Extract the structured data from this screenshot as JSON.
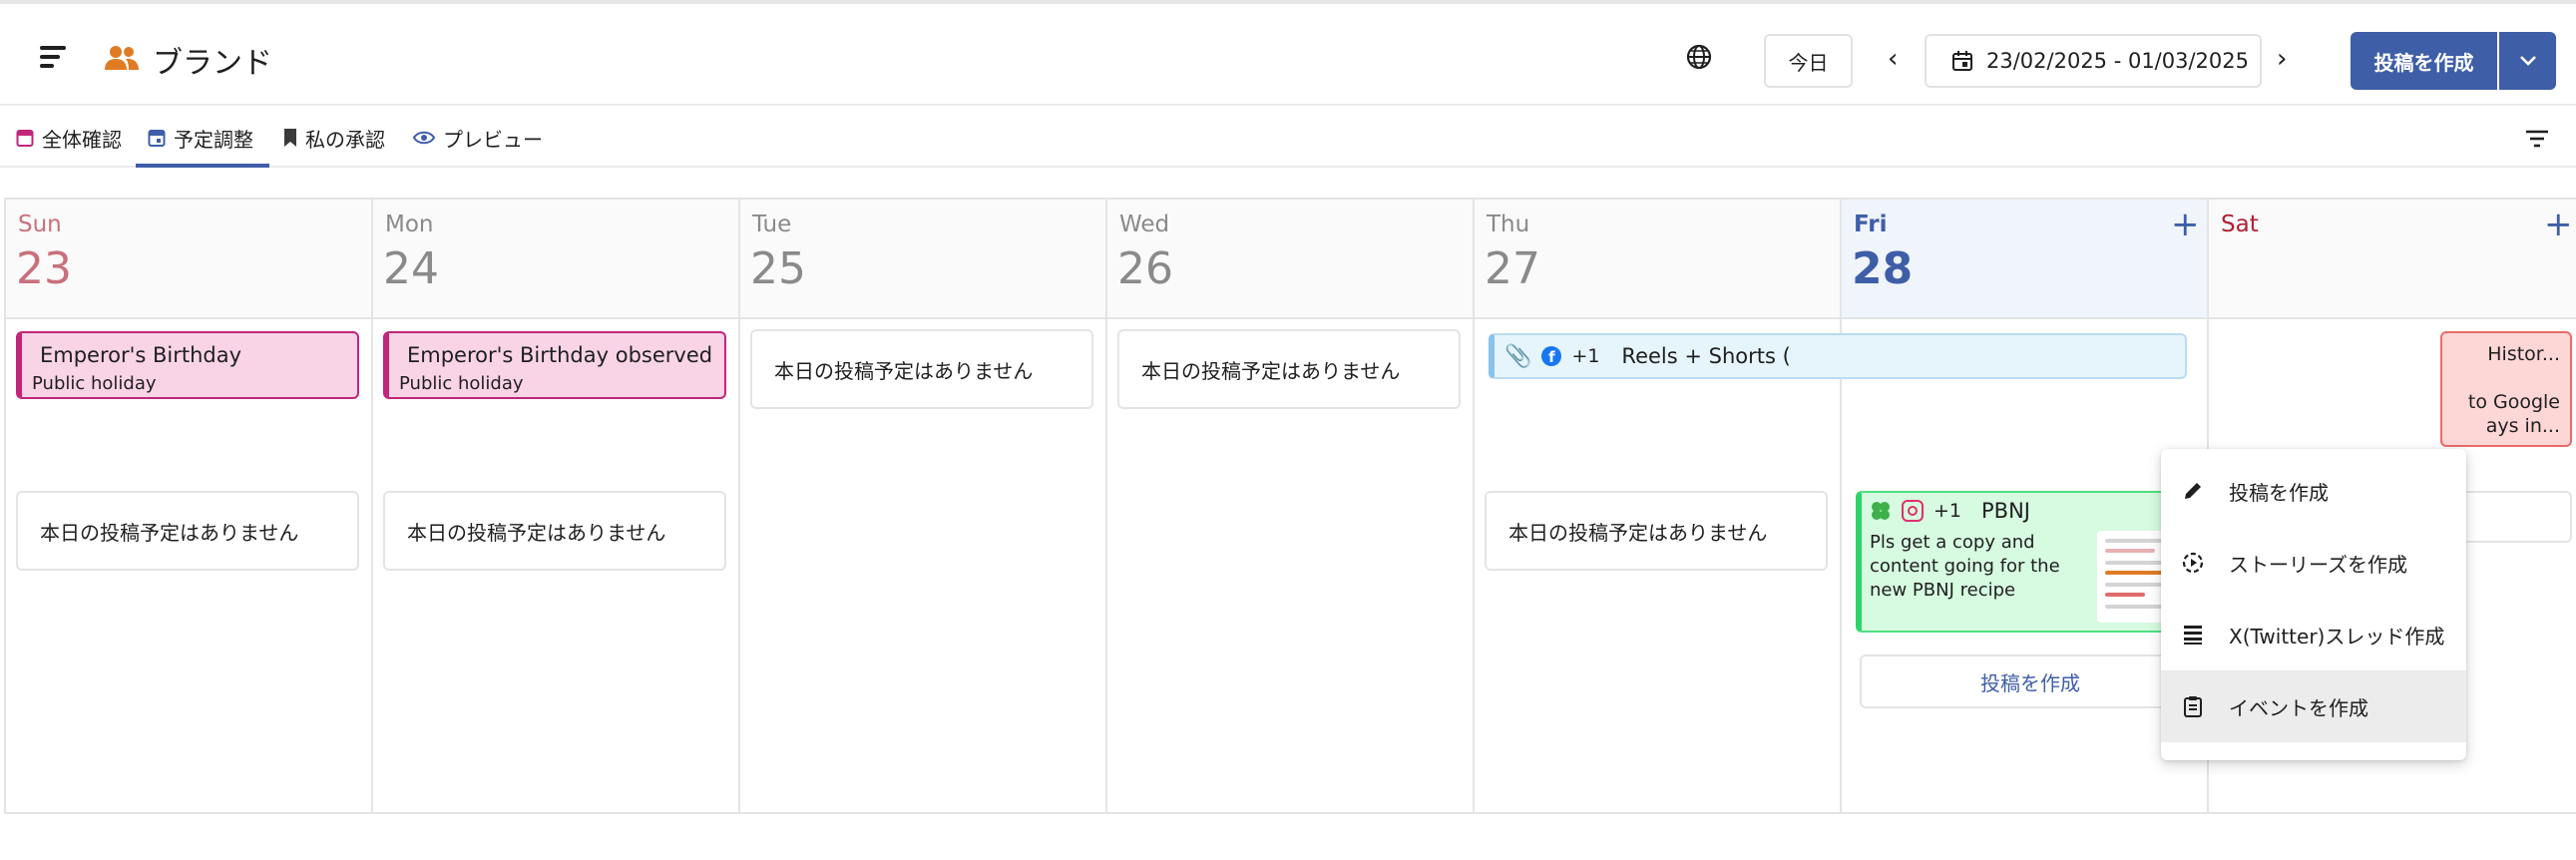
{
  "header": {
    "title": "ブランド",
    "today_label": "今日",
    "date_range": "23/02/2025 - 01/03/2025",
    "prev_label": "‹",
    "next_label": "›",
    "create_label": "投稿を作成"
  },
  "tabs": [
    {
      "label": "全体確認"
    },
    {
      "label": "予定調整"
    },
    {
      "label": "私の承認"
    },
    {
      "label": "プレビュー"
    }
  ],
  "days": [
    {
      "dow": "Sun",
      "num": "23"
    },
    {
      "dow": "Mon",
      "num": "24"
    },
    {
      "dow": "Tue",
      "num": "25"
    },
    {
      "dow": "Wed",
      "num": "26"
    },
    {
      "dow": "Thu",
      "num": "27"
    },
    {
      "dow": "Fri",
      "num": "28"
    },
    {
      "dow": "Sat",
      "num": ""
    }
  ],
  "plus_label": "+",
  "empty_text": "本日の投稿予定はありません",
  "holidays": [
    {
      "title": "Emperor's Birthday",
      "sub": "Public holiday"
    },
    {
      "title": "Emperor's Birthday observed",
      "sub": "Public holiday"
    }
  ],
  "reels": {
    "count": "+1",
    "title": "Reels + Shorts ("
  },
  "pbnj": {
    "count": "+1",
    "title": "PBNJ",
    "desc": "Pls get a copy and content going for the new PBNJ recipe"
  },
  "create_post_link": "投稿を作成",
  "sat_event": {
    "line1": "Histor...",
    "line2": "to Google",
    "line3": "ays in..."
  },
  "menu": [
    {
      "label": "投稿を作成",
      "icon": "pencil-icon"
    },
    {
      "label": "ストーリーズを作成",
      "icon": "story-icon"
    },
    {
      "label": "X(Twitter)スレッド作成",
      "icon": "thread-icon"
    },
    {
      "label": "イベントを作成",
      "icon": "clipboard-icon"
    }
  ],
  "colors": {
    "accent": "#3f5ea8",
    "holiday": "#f9d4e6",
    "reels": "#e6f4fc",
    "pbnj": "#d6fbe0"
  }
}
